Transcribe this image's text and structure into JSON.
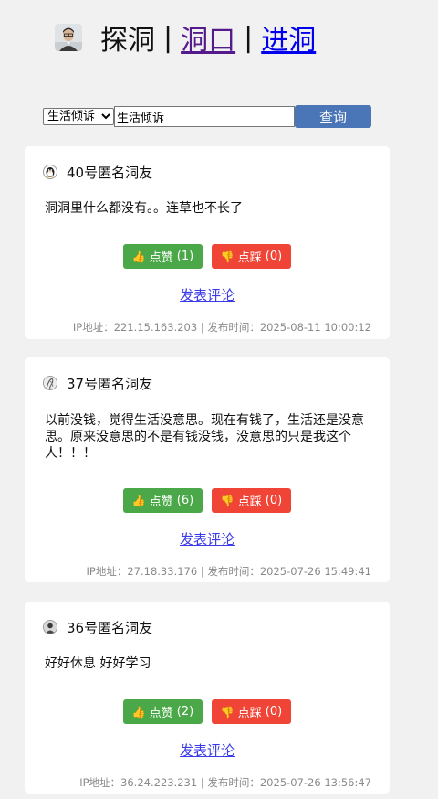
{
  "header": {
    "title": "探洞",
    "separator": "|",
    "link_dongkou": "洞口",
    "link_jindong": "进洞"
  },
  "search": {
    "category_selected": "生活倾诉",
    "query_value": "生活倾诉",
    "submit_label": "查询"
  },
  "posts": [
    {
      "author": "40号匿名洞友",
      "content": "洞洞里什么都没有。。连草也不长了",
      "like_label": "点赞",
      "like_count": "(1)",
      "dislike_label": "点踩",
      "dislike_count": "(0)",
      "comment_label": "发表评论",
      "meta": "IP地址：221.15.163.203 | 发布时间：2025-08-11 10:00:12",
      "avatar_icon": "penguin-avatar-icon"
    },
    {
      "author": "37号匿名洞友",
      "content": "以前没钱，觉得生活没意思。现在有钱了，生活还是没意思。原来没意思的不是有钱没钱，没意思的只是我这个人！！！",
      "like_label": "点赞",
      "like_count": "(6)",
      "dislike_label": "点踩",
      "dislike_count": "(0)",
      "comment_label": "发表评论",
      "meta": "IP地址：27.18.33.176 | 发布时间：2025-07-26 15:49:41",
      "avatar_icon": "sketch-avatar-icon"
    },
    {
      "author": "36号匿名洞友",
      "content": "好好休息 好好学习",
      "like_label": "点赞",
      "like_count": "(2)",
      "dislike_label": "点踩",
      "dislike_count": "(0)",
      "comment_label": "发表评论",
      "meta": "IP地址：36.24.223.231 | 发布时间：2025-07-26 13:56:47",
      "avatar_icon": "person-avatar-icon"
    }
  ],
  "colors": {
    "background": "#f1f1f1",
    "search_button": "#4a76b7",
    "like_button": "#4aa849",
    "dislike_button": "#f04437",
    "comment_link": "#3a3ae8",
    "visited_link": "#551a8b",
    "unvisited_link": "#0000ee"
  },
  "icons": {
    "like": "thumbs-up-icon",
    "dislike": "thumbs-down-icon",
    "logo": "person-photo-logo"
  }
}
